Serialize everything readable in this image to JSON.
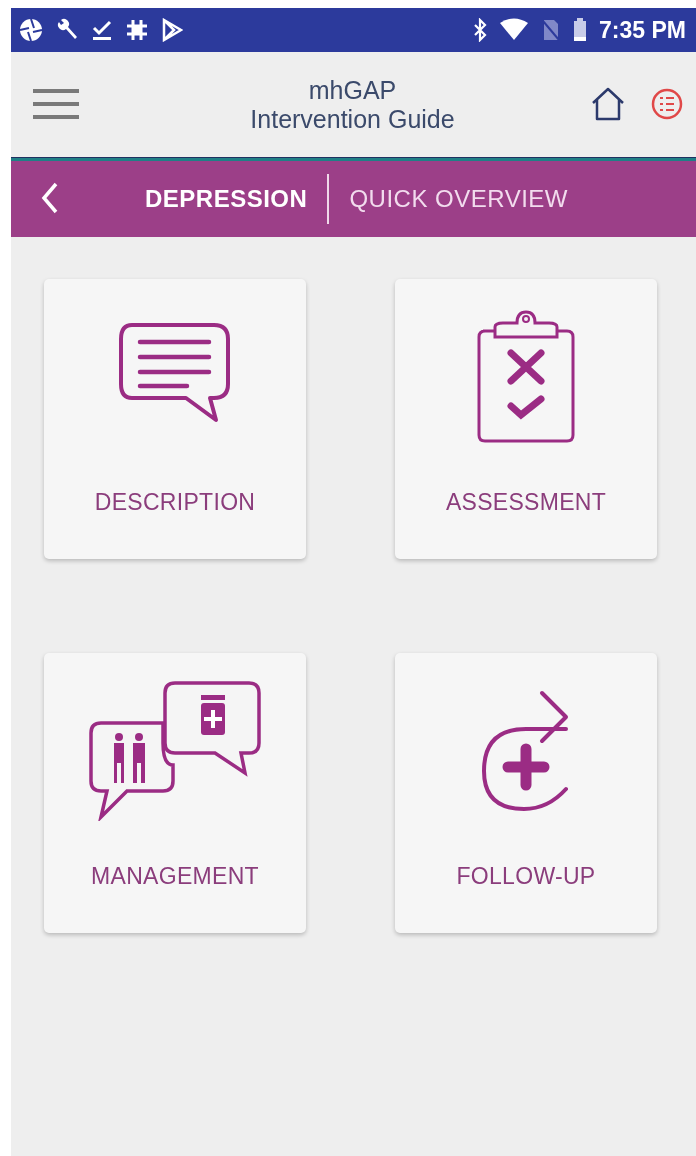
{
  "status_bar": {
    "time": "7:35 PM"
  },
  "app_bar": {
    "title_lines": [
      "mhGAP",
      "Intervention Guide"
    ]
  },
  "nav_bar": {
    "section": "DEPRESSION",
    "page": "QUICK OVERVIEW"
  },
  "tiles": [
    {
      "label": "DESCRIPTION",
      "kind": "description"
    },
    {
      "label": "ASSESSMENT",
      "kind": "assessment"
    },
    {
      "label": "MANAGEMENT",
      "kind": "management"
    },
    {
      "label": "FOLLOW-UP",
      "kind": "followup"
    }
  ]
}
